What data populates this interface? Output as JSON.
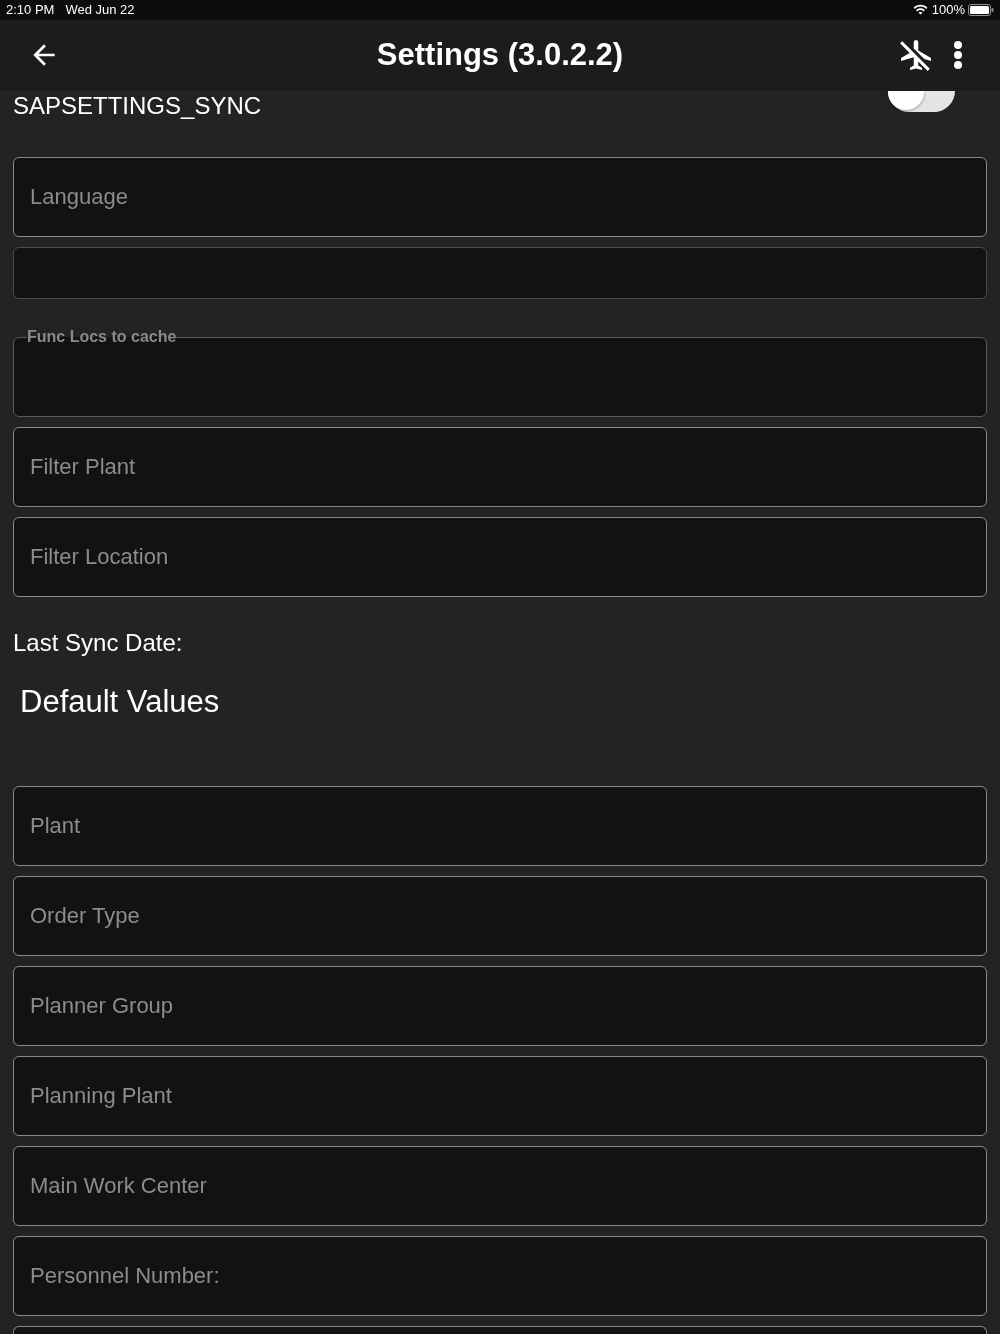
{
  "status_bar": {
    "time": "2:10 PM",
    "date": "Wed Jun 22",
    "battery": "100%"
  },
  "header": {
    "title": "Settings (3.0.2.2)"
  },
  "sync": {
    "label": "SAPSETTINGS_SYNC",
    "on": false
  },
  "sync_fields": [
    {
      "kind": "input",
      "placeholder": "Language"
    },
    {
      "kind": "compact"
    },
    {
      "kind": "outlined",
      "label": "Func Locs to cache"
    },
    {
      "kind": "input",
      "placeholder": "Filter Plant"
    },
    {
      "kind": "input",
      "placeholder": "Filter Location"
    }
  ],
  "last_sync": {
    "label": "Last Sync Date:"
  },
  "defaults": {
    "heading": "Default Values",
    "fields": [
      {
        "kind": "input",
        "placeholder": "Plant"
      },
      {
        "kind": "input",
        "placeholder": "Order Type"
      },
      {
        "kind": "input",
        "placeholder": "Planner Group"
      },
      {
        "kind": "input",
        "placeholder": "Planning Plant"
      },
      {
        "kind": "input",
        "placeholder": "Main Work Center"
      },
      {
        "kind": "input",
        "placeholder": "Personnel Number:"
      },
      {
        "kind": "partial"
      }
    ]
  }
}
